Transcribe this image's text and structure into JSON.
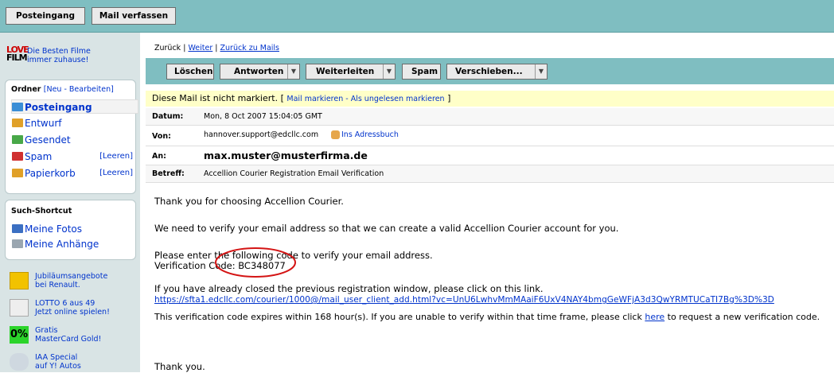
{
  "topbar": {
    "inbox_label": "Posteingang",
    "compose_label": "Mail verfassen"
  },
  "promo": {
    "logo_love": "LOVE",
    "logo_film": "FILM",
    "line1": "Die Besten Filme",
    "line2": "immer zuhause!"
  },
  "folders": {
    "title": "Ordner",
    "actions": "[Neu - Bearbeiten]",
    "items": [
      {
        "label": "Posteingang",
        "icon": "inbox-folder-icon",
        "color": "#3b8ed6"
      },
      {
        "label": "Entwurf",
        "icon": "draft-folder-icon",
        "color": "#e0a028"
      },
      {
        "label": "Gesendet",
        "icon": "sent-folder-icon",
        "color": "#48a848"
      },
      {
        "label": "Spam",
        "icon": "spam-folder-icon",
        "color": "#d03030",
        "action": "[Leeren]"
      },
      {
        "label": "Papierkorb",
        "icon": "trash-folder-icon",
        "color": "#e0a028",
        "action": "[Leeren]"
      }
    ]
  },
  "shortcuts": {
    "title": "Such-Shortcut",
    "items": [
      {
        "label": "Meine Fotos",
        "icon": "photos-icon"
      },
      {
        "label": "Meine Anhänge",
        "icon": "paperclip-icon"
      }
    ]
  },
  "ads": [
    {
      "line1": "Jubiläumsangebote",
      "line2": "bei Renault.",
      "icon": "renault-logo-icon"
    },
    {
      "line1": "LOTTO 6 aus 49",
      "line2": "Jetzt online spielen!",
      "icon": "lotto-icon"
    },
    {
      "badge": "0%",
      "line1": "Gratis",
      "line2": "MasterCard Gold!",
      "icon": "zero-percent-icon"
    },
    {
      "line1": "IAA Special",
      "line2": "auf Y! Autos",
      "icon": "car-icon"
    }
  ],
  "nav": {
    "back": "Zurück",
    "sep": "|",
    "next": "Weiter",
    "back_to_mails": "Zurück zu Mails"
  },
  "actions": {
    "delete": "Löschen",
    "reply": "Antworten",
    "forward": "Weiterleiten",
    "spam": "Spam",
    "move": "Verschieben..."
  },
  "notice": {
    "text": "Diese Mail ist nicht markiert.",
    "open": "[",
    "link": "Mail markieren - Als ungelesen markieren",
    "close": "]"
  },
  "header": {
    "date_label": "Datum:",
    "date": "Mon, 8 Oct 2007 15:04:05 GMT",
    "from_label": "Von:",
    "from": "hannover.support@edcllc.com",
    "addressbook": "Ins Adressbuch",
    "to_label": "An:",
    "to": "max.muster@musterfirma.de",
    "subject_label": "Betreff:",
    "subject": "Accellion Courier Registration Email Verification"
  },
  "body": {
    "p1": "Thank you for choosing Accellion Courier.",
    "p2": "We need to verify your email address so that we can create a valid Accellion Courier account for you.",
    "p3a": "Please enter the following code to verify your email address.",
    "p3b_label": "Verification Code: ",
    "code": "BC348077",
    "p4a": "If you have already closed the previous registration window, please click on this link.",
    "link": "https://sfta1.edcllc.com/courier/1000@/mail_user_client_add.html?vc=UnU6LwhvMmMAaiF6UxV4NAY4bmgGeWFjA3d3QwYRMTUCaTI7Bg%3D%3D",
    "p5a": "This verification code expires within 168 hour(s). If you are unable to verify within that time frame, please click ",
    "p5link": "here",
    "p5b": " to request a new verification code.",
    "p6": "Thank you."
  }
}
